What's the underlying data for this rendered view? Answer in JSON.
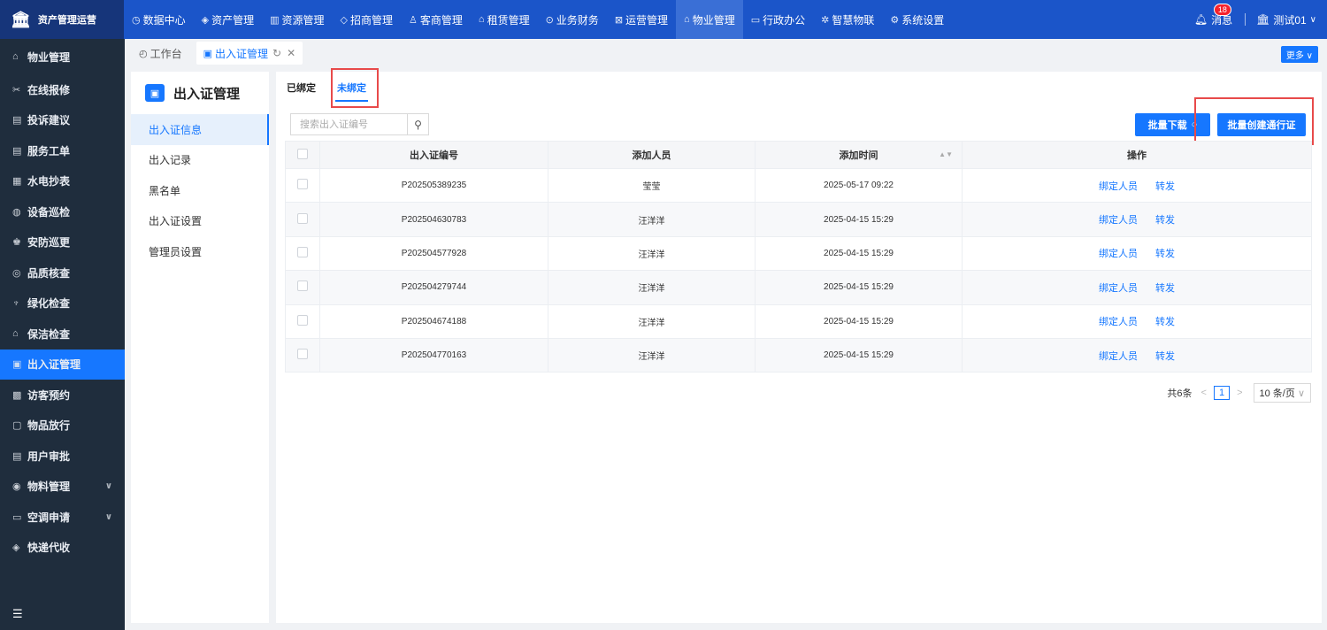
{
  "app": {
    "brand": "资产管理运营"
  },
  "topnav": [
    {
      "label": "数据中心",
      "icon": "clock-icon"
    },
    {
      "label": "资产管理",
      "icon": "cube-icon"
    },
    {
      "label": "资源管理",
      "icon": "building-icon"
    },
    {
      "label": "招商管理",
      "icon": "tag-icon"
    },
    {
      "label": "客商管理",
      "icon": "people-icon"
    },
    {
      "label": "租赁管理",
      "icon": "house-icon"
    },
    {
      "label": "业务财务",
      "icon": "finance-icon"
    },
    {
      "label": "运营管理",
      "icon": "operations-icon"
    },
    {
      "label": "物业管理",
      "icon": "home-icon",
      "active": true
    },
    {
      "label": "行政办公",
      "icon": "monitor-icon"
    },
    {
      "label": "智慧物联",
      "icon": "iot-icon"
    },
    {
      "label": "系统设置",
      "icon": "settings-icon"
    }
  ],
  "header": {
    "messages_label": "消息",
    "messages_count": "18",
    "user": "测试01"
  },
  "sidebar": {
    "items": [
      {
        "label": "物业管理",
        "icon": "home-icon"
      },
      {
        "label": "在线报修",
        "icon": "repair-icon"
      },
      {
        "label": "投诉建议",
        "icon": "complaint-icon"
      },
      {
        "label": "服务工单",
        "icon": "ticket-icon"
      },
      {
        "label": "水电抄表",
        "icon": "meter-icon"
      },
      {
        "label": "设备巡检",
        "icon": "device-icon"
      },
      {
        "label": "安防巡更",
        "icon": "security-icon"
      },
      {
        "label": "品质核查",
        "icon": "quality-icon"
      },
      {
        "label": "绿化检查",
        "icon": "plant-icon"
      },
      {
        "label": "保洁检查",
        "icon": "clean-icon"
      },
      {
        "label": "出入证管理",
        "icon": "pass-icon",
        "active": true
      },
      {
        "label": "访客预约",
        "icon": "visitor-icon"
      },
      {
        "label": "物品放行",
        "icon": "goods-icon"
      },
      {
        "label": "用户审批",
        "icon": "approval-icon"
      },
      {
        "label": "物料管理",
        "icon": "material-icon",
        "expandable": true
      },
      {
        "label": "空调申请",
        "icon": "aircon-icon",
        "expandable": true
      },
      {
        "label": "快递代收",
        "icon": "parcel-icon"
      }
    ]
  },
  "tabs": [
    {
      "label": "工作台",
      "icon": "dashboard-icon"
    },
    {
      "label": "出入证管理",
      "icon": "pass-icon",
      "active": true
    }
  ],
  "tabs_more": "更多",
  "submenu": {
    "title": "出入证管理",
    "items": [
      "出入证信息",
      "出入记录",
      "黑名单",
      "出入证设置",
      "管理员设置"
    ]
  },
  "subtabs": [
    {
      "label": "已绑定"
    },
    {
      "label": "未绑定",
      "active": true
    }
  ],
  "search": {
    "placeholder": "搜索出入证编号"
  },
  "actions": {
    "download": "批量下载",
    "create": "批量创建通行证"
  },
  "table": {
    "headers": [
      "出入证编号",
      "添加人员",
      "添加时间",
      "操作"
    ],
    "rows": [
      {
        "code": "P202505389235",
        "person": "莹莹",
        "time": "2025-05-17 09:22"
      },
      {
        "code": "P202504630783",
        "person": "汪洋洋",
        "time": "2025-04-15 15:29"
      },
      {
        "code": "P202504577928",
        "person": "汪洋洋",
        "time": "2025-04-15 15:29"
      },
      {
        "code": "P202504279744",
        "person": "汪洋洋",
        "time": "2025-04-15 15:29"
      },
      {
        "code": "P202504674188",
        "person": "汪洋洋",
        "time": "2025-04-15 15:29"
      },
      {
        "code": "P202504770163",
        "person": "汪洋洋",
        "time": "2025-04-15 15:29"
      }
    ],
    "row_actions": [
      "绑定人员",
      "转发"
    ]
  },
  "pagination": {
    "total": "共6条",
    "current": "1",
    "page_size": "10 条/页"
  },
  "colors": {
    "primary": "#1677ff",
    "topbar": "#1b55c9",
    "sidebar": "#1f2d3d",
    "highlight": "#e84a4a"
  }
}
